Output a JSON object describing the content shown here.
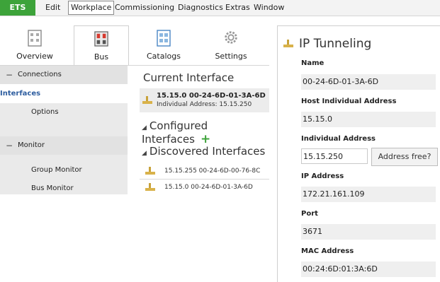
{
  "menubar": {
    "items": [
      "ETS",
      "Edit",
      "Workplace",
      "Commissioning",
      "Diagnostics",
      "Extras",
      "Window"
    ]
  },
  "ribbon": {
    "tiles": [
      {
        "label": "Overview",
        "icon": "overview-icon"
      },
      {
        "label": "Bus",
        "icon": "bus-icon"
      },
      {
        "label": "Catalogs",
        "icon": "catalogs-icon"
      },
      {
        "label": "Settings",
        "icon": "settings-gear-icon"
      }
    ]
  },
  "nav": {
    "connections": "Connections",
    "interfaces": "Interfaces",
    "options": "Options",
    "monitor": "Monitor",
    "group_monitor": "Group Monitor",
    "bus_monitor": "Bus Monitor"
  },
  "main": {
    "current_interface_title": "Current Interface",
    "current_line1": "15.15.0 00-24-6D-01-3A-6D",
    "current_line2": "Individual Address: 15.15.250",
    "configured_title": "Configured Interfaces",
    "discovered_title": "Discovered Interfaces",
    "discovered": [
      "15.15.255 00-24-6D-00-76-8C",
      "15.15.0 00-24-6D-01-3A-6D"
    ]
  },
  "panel": {
    "title": "IP Tunneling",
    "name_label": "Name",
    "name_value": "00-24-6D-01-3A-6D",
    "host_label": "Host Individual Address",
    "host_value": "15.15.0",
    "ind_label": "Individual Address",
    "ind_value": "15.15.250",
    "address_free_button": "Address free?",
    "ip_label": "IP Address",
    "ip_value": "172.21.161.109",
    "port_label": "Port",
    "port_value": "3671",
    "mac_label": "MAC Address",
    "mac_value": "00:24:6D:01:3A:6D"
  },
  "colors": {
    "accent_green": "#3da33a",
    "selected_text": "#2d5d9f"
  }
}
